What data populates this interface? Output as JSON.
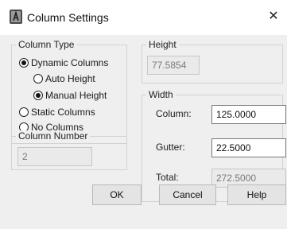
{
  "window": {
    "title": "Column Settings",
    "close_glyph": "✕",
    "icon": "autocad-app-icon"
  },
  "column_type": {
    "legend": "Column Type",
    "dynamic_label": "Dynamic Columns",
    "auto_height_label": "Auto Height",
    "manual_height_label": "Manual Height",
    "static_label": "Static Columns",
    "no_columns_label": "No Columns",
    "selected": "Dynamic Columns",
    "height_mode": "Manual Height"
  },
  "column_number": {
    "legend": "Column Number",
    "value": "2"
  },
  "height": {
    "legend": "Height",
    "value": "77.5854"
  },
  "width": {
    "legend": "Width",
    "column_label": "Column:",
    "column_value": "125.0000",
    "gutter_label": "Gutter:",
    "gutter_value": "22.5000",
    "total_label": "Total:",
    "total_value": "272.5000"
  },
  "buttons": {
    "ok": "OK",
    "cancel": "Cancel",
    "help": "Help"
  }
}
